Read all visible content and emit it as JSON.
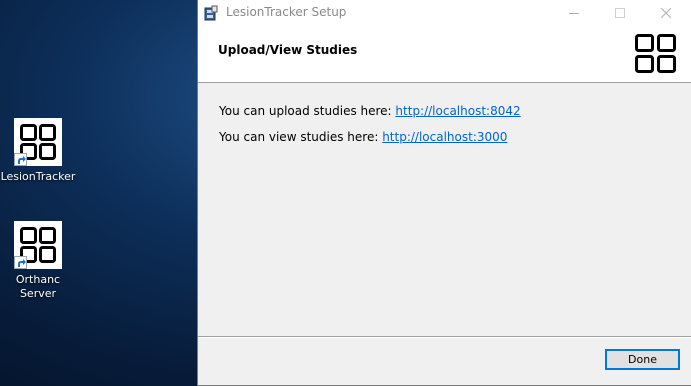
{
  "desktop": {
    "icons": [
      {
        "label": "LesionTracker",
        "icon": "four-squares-logo-icon"
      },
      {
        "label": "Orthanc Server",
        "icon": "four-squares-logo-icon"
      }
    ]
  },
  "window": {
    "title": "LesionTracker Setup",
    "controls": [
      "minimize-icon",
      "maximize-icon",
      "close-icon"
    ],
    "header": {
      "heading": "Upload/View Studies",
      "logo": "four-squares-logo-icon"
    },
    "content": {
      "upload_text": "You can upload studies here: ",
      "upload_link": "http://localhost:8042",
      "view_text": "You can view studies here: ",
      "view_link": "http://localhost:3000"
    },
    "buttons": {
      "done_label": "Done"
    }
  }
}
